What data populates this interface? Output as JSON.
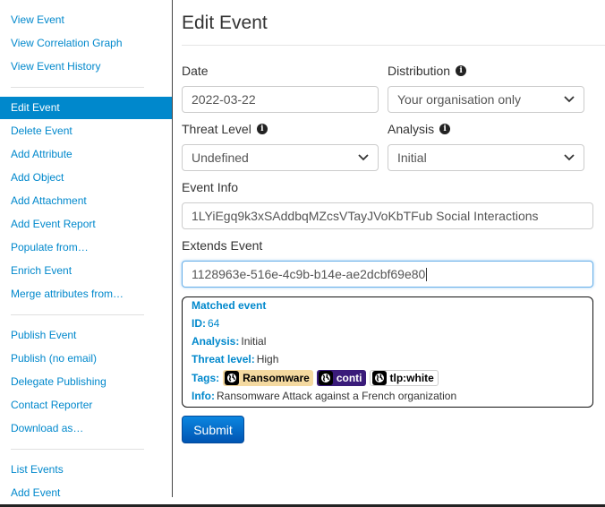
{
  "sidebar": {
    "group1": [
      "View Event",
      "View Correlation Graph",
      "View Event History"
    ],
    "group2": [
      "Edit Event",
      "Delete Event",
      "Add Attribute",
      "Add Object",
      "Add Attachment",
      "Add Event Report",
      "Populate from…",
      "Enrich Event",
      "Merge attributes from…"
    ],
    "group3": [
      "Publish Event",
      "Publish (no email)",
      "Delegate Publishing",
      "Contact Reporter",
      "Download as…"
    ],
    "group4": [
      "List Events",
      "Add Event"
    ],
    "active": "Edit Event"
  },
  "page": {
    "title": "Edit Event"
  },
  "form": {
    "date_label": "Date",
    "date_value": "2022-03-22",
    "distribution_label": "Distribution",
    "distribution_value": "Your organisation only",
    "threat_level_label": "Threat Level",
    "threat_level_value": "Undefined",
    "analysis_label": "Analysis",
    "analysis_value": "Initial",
    "event_info_label": "Event Info",
    "event_info_value": "1LYiEgq9k3xSAddbqMZcsVTayJVoKbTFub Social Interactions",
    "extends_label": "Extends Event",
    "extends_value": "1128963e-516e-4c9b-b14e-ae2dcbf69e80",
    "submit_label": "Submit"
  },
  "matched": {
    "heading": "Matched event",
    "id_key": "ID:",
    "id_value": "64",
    "analysis_key": "Analysis:",
    "analysis_value": "Initial",
    "threat_key": "Threat level:",
    "threat_value": "High",
    "tags_key": "Tags:",
    "tags": [
      "Ransomware",
      "conti",
      "tlp:white"
    ],
    "info_key": "Info:",
    "info_value": "Ransomware Attack against a French organization"
  },
  "colors": {
    "link": "#0088cc",
    "active_bg": "#0088cc",
    "tag_ransomware": "#f4d9a0",
    "tag_conti": "#3a1b7a",
    "tag_tlp": "#ffffff",
    "submit": "#0066cc"
  },
  "icons": [
    "info-icon",
    "chevron-down-icon",
    "globe-icon"
  ]
}
